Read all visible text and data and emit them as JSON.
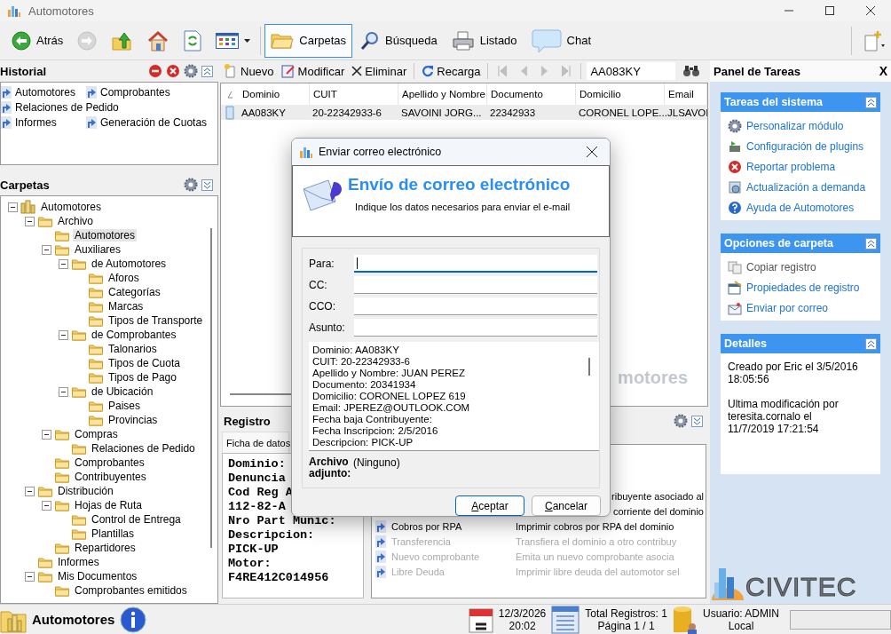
{
  "window": {
    "title": "Automotores"
  },
  "toolbar": {
    "items": [
      {
        "label": "Atrás",
        "disabled": false,
        "selected": false
      },
      {
        "disabled": true,
        "selected": false
      },
      {
        "disabled": false,
        "selected": false
      },
      {
        "disabled": false,
        "selected": false
      },
      {
        "disabled": false,
        "selected": false
      },
      {
        "disabled": false,
        "selected": false
      },
      {
        "label": "Carpetas",
        "disabled": false,
        "selected": true
      },
      {
        "label": "Búsqueda",
        "disabled": false,
        "selected": false
      },
      {
        "label": "Listado",
        "disabled": false,
        "selected": false
      },
      {
        "label": "Chat",
        "disabled": false,
        "selected": false
      }
    ]
  },
  "historial": {
    "title": "Historial",
    "links": [
      "Automotores",
      "Comprobantes",
      "Relaciones de Pedido",
      "Informes",
      "Generación de Cuotas"
    ]
  },
  "carpetas": {
    "title": "Carpetas",
    "tree": [
      {
        "label": "Automotores",
        "selected": false,
        "children": [
          {
            "label": "Archivo",
            "selected": false,
            "children": [
              {
                "label": "Automotores",
                "selected": true
              },
              {
                "label": "Auxiliares",
                "selected": false,
                "children": [
                  {
                    "label": "de Automotores",
                    "selected": false,
                    "children": [
                      {
                        "label": "Aforos",
                        "selected": false
                      },
                      {
                        "label": "Categorías",
                        "selected": false
                      },
                      {
                        "label": "Marcas",
                        "selected": false
                      },
                      {
                        "label": "Tipos de Transporte",
                        "selected": false
                      }
                    ]
                  },
                  {
                    "label": "de Comprobantes",
                    "selected": false,
                    "children": [
                      {
                        "label": "Talonarios",
                        "selected": false
                      },
                      {
                        "label": "Tipos de Cuota",
                        "selected": false
                      },
                      {
                        "label": "Tipos de Pago",
                        "selected": false
                      }
                    ]
                  },
                  {
                    "label": "de Ubicación",
                    "selected": false,
                    "children": [
                      {
                        "label": "Paises",
                        "selected": false
                      },
                      {
                        "label": "Provincias",
                        "selected": false
                      }
                    ]
                  }
                ]
              },
              {
                "label": "Compras",
                "selected": false,
                "children": [
                  {
                    "label": "Relaciones de Pedido",
                    "selected": false
                  }
                ]
              },
              {
                "label": "Comprobantes",
                "selected": false
              },
              {
                "label": "Contribuyentes",
                "selected": false
              }
            ]
          },
          {
            "label": "Distribución",
            "selected": false,
            "children": [
              {
                "label": "Hojas de Ruta",
                "selected": false,
                "children": [
                  {
                    "label": "Control de Entrega",
                    "selected": false
                  },
                  {
                    "label": "Plantillas",
                    "selected": false
                  }
                ]
              },
              {
                "label": "Repartidores",
                "selected": false
              }
            ]
          },
          {
            "label": "Informes",
            "selected": false
          },
          {
            "label": "Mis Documentos",
            "selected": false,
            "children": [
              {
                "label": "Comprobantes emitidos",
                "selected": false
              }
            ]
          }
        ]
      }
    ]
  },
  "record_toolbar": {
    "buttons": [
      "Nuevo",
      "Modificar",
      "Eliminar",
      "Recarga"
    ],
    "nav": [
      {
        "disabled": true
      },
      {
        "disabled": true
      },
      {
        "disabled": true
      },
      {
        "disabled": true
      }
    ],
    "search": {
      "value": "AA083KY"
    }
  },
  "table": {
    "columns": [
      "Dominio",
      "CUIT",
      "Apellido y Nombre",
      "Documento",
      "Domicilio",
      "Email"
    ],
    "rows": [
      {
        "selected": true,
        "cells": [
          "AA083KY",
          "20-22342933-6",
          "SAVOINI JORG...",
          "22342933",
          "CORONEL LOPE...",
          "JLSAVOI"
        ]
      }
    ],
    "caption": "motores"
  },
  "registro": {
    "title": "Registro",
    "tab": "Ficha de datos",
    "ficha": [
      "Dominio:",
      "Denuncia",
      "Cod Reg A",
      "112-82-A",
      "Nro Part Munic:",
      "Descripcion:",
      "PICK-UP",
      "Motor:",
      "F4RE412C014956"
    ],
    "actions": [
      {
        "kind": "covered",
        "description": "ribuyente asociado al",
        "disabled": false
      },
      {
        "kind": "covered",
        "description": "corriente del dominio",
        "disabled": false
      },
      {
        "kind": "full",
        "name": "Cobros por RPA",
        "description": "Imprimir cobros por RPA del dominio",
        "disabled": false
      },
      {
        "kind": "full",
        "name": "Transferencia",
        "description": "Transfiera el dominio a otro contribuy",
        "disabled": true
      },
      {
        "kind": "full",
        "name": "Nuevo comprobante",
        "description": "Emita un nuevo comprobante asocia",
        "disabled": true
      },
      {
        "kind": "full",
        "name": "Libre Deuda",
        "description": "Imprimir libre deuda del automotor sel",
        "disabled": true
      }
    ]
  },
  "dialog": {
    "title": "Enviar correo electrónico",
    "heading": "Envío de correo electrónico",
    "subtitle": "Indique los datos necesarios para enviar el e-mail",
    "fields": [
      {
        "label": "Para:",
        "focused": true
      },
      {
        "label": "CC:",
        "focused": false
      },
      {
        "label": "CCO:",
        "focused": false
      },
      {
        "label": "Asunto:",
        "focused": false
      }
    ],
    "body": [
      "Dominio: AA083KY",
      "CUIT: 20-22342933-6",
      "Apellido y Nombre: JUAN PEREZ",
      "Documento: 20341934",
      "Domicilio: CORONEL LOPEZ 619",
      "Email: JPEREZ@OUTLOOK.COM",
      "Fecha baja Contribuyente:",
      "Fecha Inscripcion: 2/5/2016",
      "Descripcion: PICK-UP"
    ],
    "attachment": {
      "label": "Archivo adjunto:",
      "value": "(Ninguno)"
    },
    "buttons": [
      {
        "label": "Aceptar",
        "default": true
      },
      {
        "label": "Cancelar",
        "default": false
      }
    ]
  },
  "task_panel": {
    "title": "Panel de Tareas",
    "close": "X",
    "sections": [
      {
        "title": "Tareas del sistema",
        "kind": "links",
        "items": [
          {
            "label": "Personalizar módulo",
            "disabled": false
          },
          {
            "label": "Configuración de plugins",
            "disabled": false
          },
          {
            "label": "Reportar problema",
            "disabled": false
          },
          {
            "label": "Actualización a demanda",
            "disabled": false
          },
          {
            "label": "Ayuda de Automotores",
            "disabled": false
          }
        ]
      },
      {
        "title": "Opciones de carpeta",
        "kind": "links",
        "items": [
          {
            "label": "Copiar registro",
            "disabled": true
          },
          {
            "label": "Propiedades de registro",
            "disabled": false
          },
          {
            "label": "Enviar por correo",
            "disabled": false
          }
        ]
      },
      {
        "title": "Detalles",
        "kind": "text",
        "lines": [
          "Creado por Eric el 3/5/2016 18:05:56",
          "Ultima modificación por teresita.cornalo el 11/7/2019 17:21:54"
        ]
      }
    ],
    "logo": "CIVITEC"
  },
  "status_bar": {
    "module": "Automotores",
    "date": "12/3/2026",
    "time": "20:02",
    "total": "Total Registros: 1",
    "page": "Página 1 / 1",
    "user": "Usuario: ADMIN",
    "location": "Local"
  }
}
